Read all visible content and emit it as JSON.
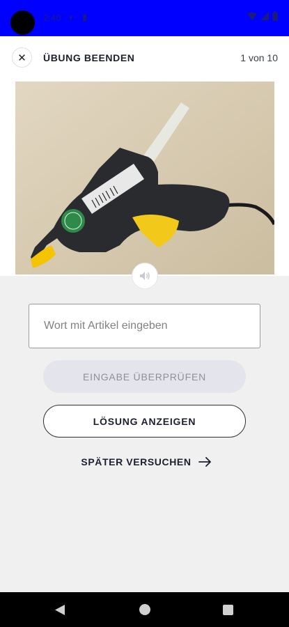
{
  "status_bar": {
    "time": "2:40",
    "icons": [
      "settings-icon",
      "battery-saver-icon",
      "wifi-icon",
      "signal-icon",
      "battery-icon"
    ]
  },
  "header": {
    "title": "ÜBUNG BEENDEN",
    "progress": "1 von 10",
    "close_icon": "close-icon"
  },
  "exercise": {
    "image_subject": "glue-gun",
    "sound_icon": "speaker-icon",
    "input_placeholder": "Wort mit Artikel eingeben",
    "input_value": ""
  },
  "actions": {
    "check_label": "EINGABE ÜBERPRÜFEN",
    "solution_label": "LÖSUNG ANZEIGEN",
    "later_label": "SPÄTER VERSUCHEN",
    "later_icon": "arrow-right-icon"
  },
  "colors": {
    "status_bar": "#0000ff",
    "background": "#f0f0f1",
    "disabled_button": "#e4e5ec",
    "text_dark": "#1b1f2e"
  }
}
